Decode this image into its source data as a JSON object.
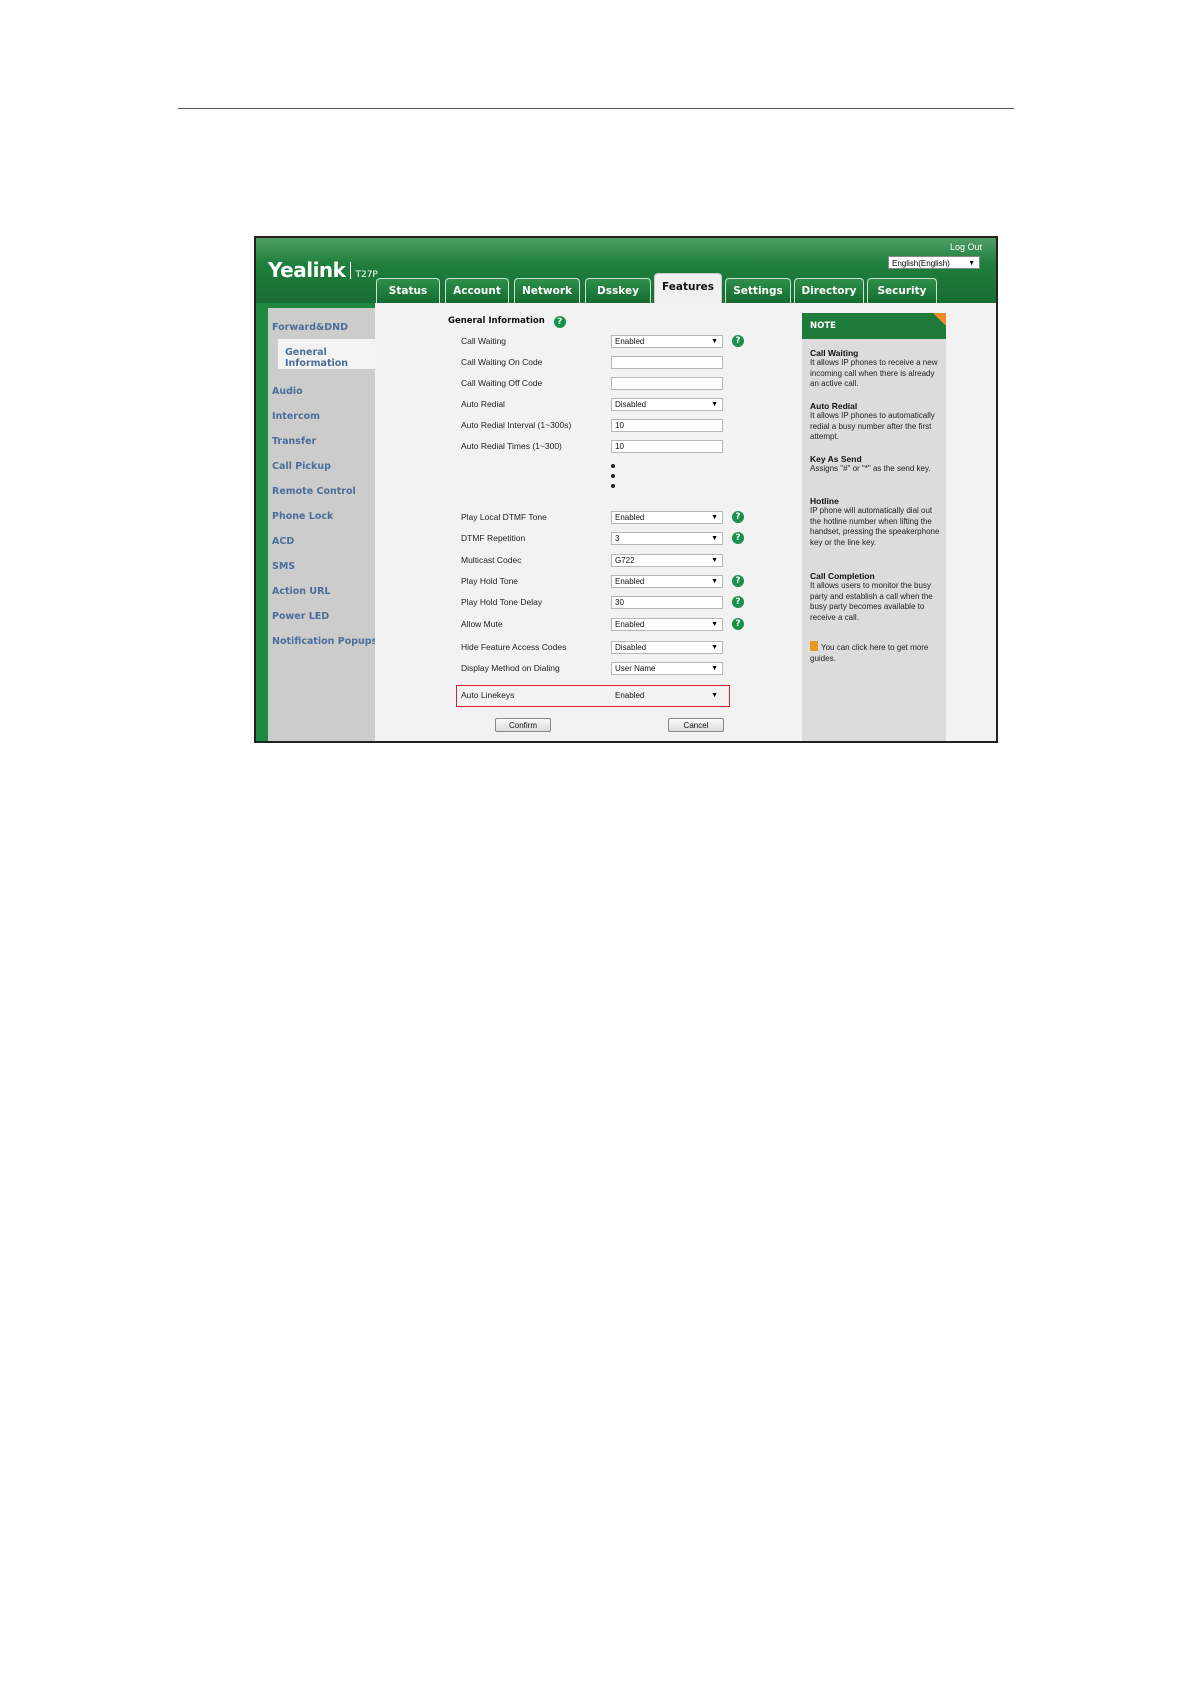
{
  "header": {
    "brand": "Yealink",
    "model": "T27P",
    "logout": "Log Out",
    "language": "English(English)"
  },
  "tabs": [
    {
      "label": "Status"
    },
    {
      "label": "Account"
    },
    {
      "label": "Network"
    },
    {
      "label": "Dsskey"
    },
    {
      "label": "Features",
      "active": true
    },
    {
      "label": "Settings"
    },
    {
      "label": "Directory"
    },
    {
      "label": "Security"
    }
  ],
  "sidebar": {
    "items": [
      {
        "label": "Forward&DND"
      },
      {
        "label": "General",
        "label2": "Information",
        "active": true
      },
      {
        "label": "Audio"
      },
      {
        "label": "Intercom"
      },
      {
        "label": "Transfer"
      },
      {
        "label": "Call Pickup"
      },
      {
        "label": "Remote Control"
      },
      {
        "label": "Phone Lock"
      },
      {
        "label": "ACD"
      },
      {
        "label": "SMS"
      },
      {
        "label": "Action URL"
      },
      {
        "label": "Power LED"
      },
      {
        "label": "Notification Popups"
      }
    ]
  },
  "form": {
    "title": "General Information",
    "rows": [
      {
        "label": "Call Waiting",
        "value": "Enabled"
      },
      {
        "label": "Call Waiting On Code",
        "value": ""
      },
      {
        "label": "Call Waiting Off Code",
        "value": ""
      },
      {
        "label": "Auto Redial",
        "value": "Disabled"
      },
      {
        "label": "Auto Redial Interval (1~300s)",
        "value": "10"
      },
      {
        "label": "Auto Redial Times (1~300)",
        "value": "10"
      },
      {
        "label": "Play Local DTMF Tone",
        "value": "Enabled"
      },
      {
        "label": "DTMF Repetition",
        "value": "3"
      },
      {
        "label": "Multicast Codec",
        "value": "G722"
      },
      {
        "label": "Play Hold Tone",
        "value": "Enabled"
      },
      {
        "label": "Play Hold Tone Delay",
        "value": "30"
      },
      {
        "label": "Allow Mute",
        "value": "Enabled"
      },
      {
        "label": "Hide Feature Access Codes",
        "value": "Disabled"
      },
      {
        "label": "Display Method on Dialing",
        "value": "User Name"
      },
      {
        "label": "Auto Linekeys",
        "value": "Enabled"
      }
    ],
    "confirm": "Confirm",
    "cancel": "Cancel"
  },
  "note": {
    "title": "NOTE",
    "sections": [
      {
        "heading": "Call Waiting",
        "text": "It allows IP phones to receive a new incoming call when there is already an active call."
      },
      {
        "heading": "Auto Redial",
        "text": "It allows IP phones to automatically redial a busy number after the first attempt."
      },
      {
        "heading": "Key As Send",
        "text": "Assigns \"#\" or \"*\" as the send key."
      },
      {
        "heading": "Hotline",
        "text": "IP phone will automatically dial out the hotline number when lifting the handset, pressing the speakerphone key or the line key."
      },
      {
        "heading": "Call Completion",
        "text": "It allows users to monitor the busy party and establish a call when the busy party becomes available to receive a call."
      }
    ],
    "guide": "You can click here to get more guides."
  },
  "colors": {
    "brand_green": "#1f7f3d",
    "help_green": "#17914b",
    "highlight_red": "#e0202a",
    "sidebar_link": "#4a6f9a"
  }
}
